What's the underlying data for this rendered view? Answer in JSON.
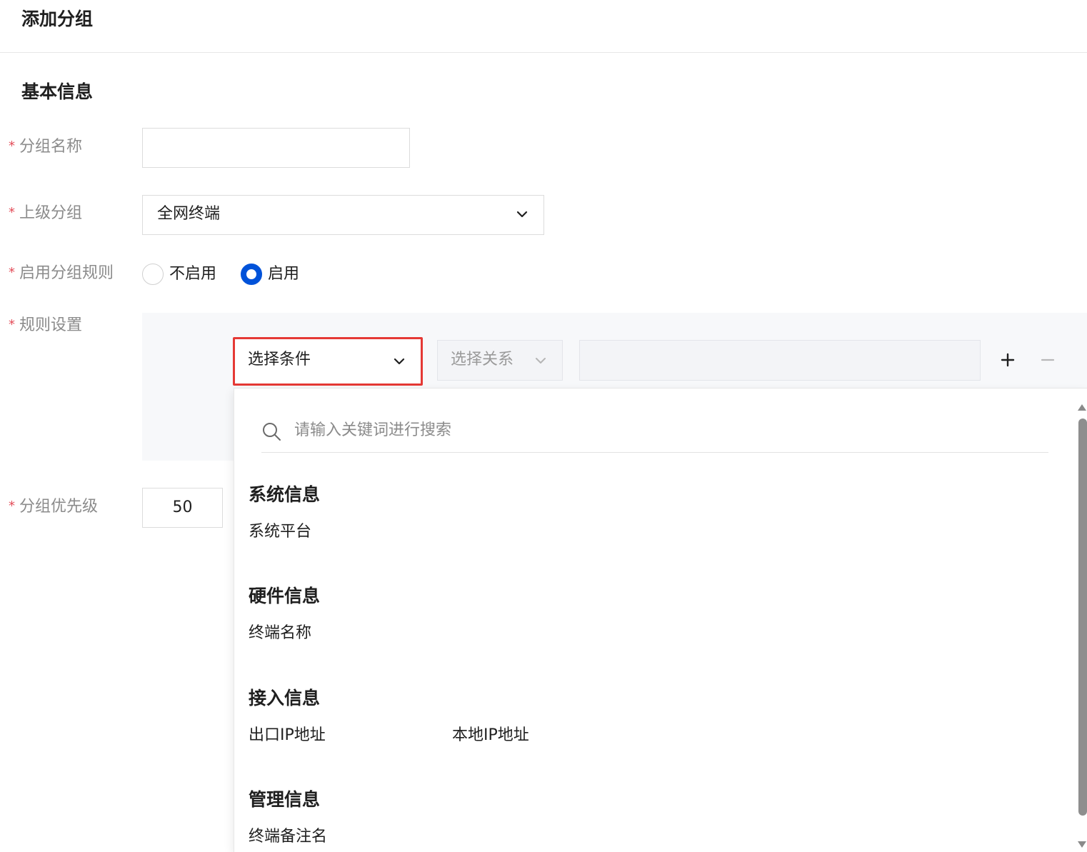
{
  "header": {
    "title": "添加分组"
  },
  "basic_info": {
    "title": "基本信息"
  },
  "form": {
    "required_mark": "*",
    "group_name": {
      "label": "分组名称",
      "value": ""
    },
    "parent_group": {
      "label": "上级分组",
      "value": "全网终端"
    },
    "enable_rules": {
      "label": "启用分组规则",
      "options": [
        {
          "label": "不启用",
          "checked": false
        },
        {
          "label": "启用",
          "checked": true
        }
      ]
    },
    "rule_settings": {
      "label": "规则设置",
      "condition_placeholder": "选择条件",
      "relation_placeholder": "选择关系",
      "value": "",
      "add_icon": "plus-icon",
      "remove_icon": "minus-icon"
    },
    "priority": {
      "label": "分组优先级",
      "value": "50"
    }
  },
  "dropdown": {
    "search_placeholder": "请输入关键词进行搜索",
    "groups": [
      {
        "title": "系统信息",
        "items": [
          "系统平台"
        ]
      },
      {
        "title": "硬件信息",
        "items": [
          "终端名称"
        ]
      },
      {
        "title": "接入信息",
        "items": [
          "出口IP地址",
          "本地IP地址"
        ]
      },
      {
        "title": "管理信息",
        "items": [
          "终端备注名"
        ]
      }
    ]
  },
  "colors": {
    "accent": "#0052d9",
    "required": "#e34d59",
    "highlight_border": "#e53935"
  }
}
